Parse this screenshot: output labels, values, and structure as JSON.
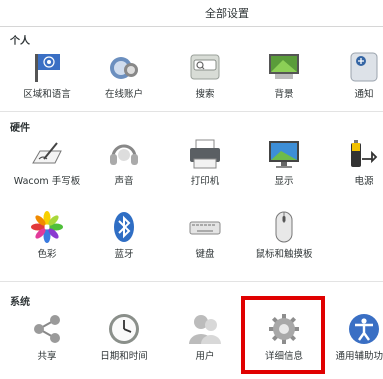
{
  "header": {
    "title": "全部设置"
  },
  "sections": {
    "personal": {
      "label": "个人",
      "items": [
        {
          "label": "区域和语言",
          "icon": "region-flag-icon"
        },
        {
          "label": "在线账户",
          "icon": "online-accounts-icon"
        },
        {
          "label": "搜索",
          "icon": "search-icon"
        },
        {
          "label": "背景",
          "icon": "background-icon"
        },
        {
          "label": "通知",
          "icon": "notifications-icon"
        }
      ]
    },
    "hardware": {
      "label": "硬件",
      "items": [
        {
          "label": "Wacom 手写板",
          "icon": "wacom-tablet-icon"
        },
        {
          "label": "声音",
          "icon": "sound-headset-icon"
        },
        {
          "label": "打印机",
          "icon": "printer-icon"
        },
        {
          "label": "显示",
          "icon": "display-icon"
        },
        {
          "label": "电源",
          "icon": "power-icon"
        },
        {
          "label": "色彩",
          "icon": "color-icon"
        },
        {
          "label": "蓝牙",
          "icon": "bluetooth-icon"
        },
        {
          "label": "键盘",
          "icon": "keyboard-icon"
        },
        {
          "label": "鼠标和触摸板",
          "icon": "mouse-icon"
        }
      ]
    },
    "system": {
      "label": "系统",
      "items": [
        {
          "label": "共享",
          "icon": "share-icon"
        },
        {
          "label": "日期和时间",
          "icon": "clock-icon"
        },
        {
          "label": "用户",
          "icon": "users-icon"
        },
        {
          "label": "详细信息",
          "icon": "gear-icon"
        },
        {
          "label": "通用辅助功能",
          "icon": "accessibility-icon"
        }
      ]
    }
  },
  "colors": {
    "highlight": "#e00000",
    "accent": "#3465a4"
  }
}
